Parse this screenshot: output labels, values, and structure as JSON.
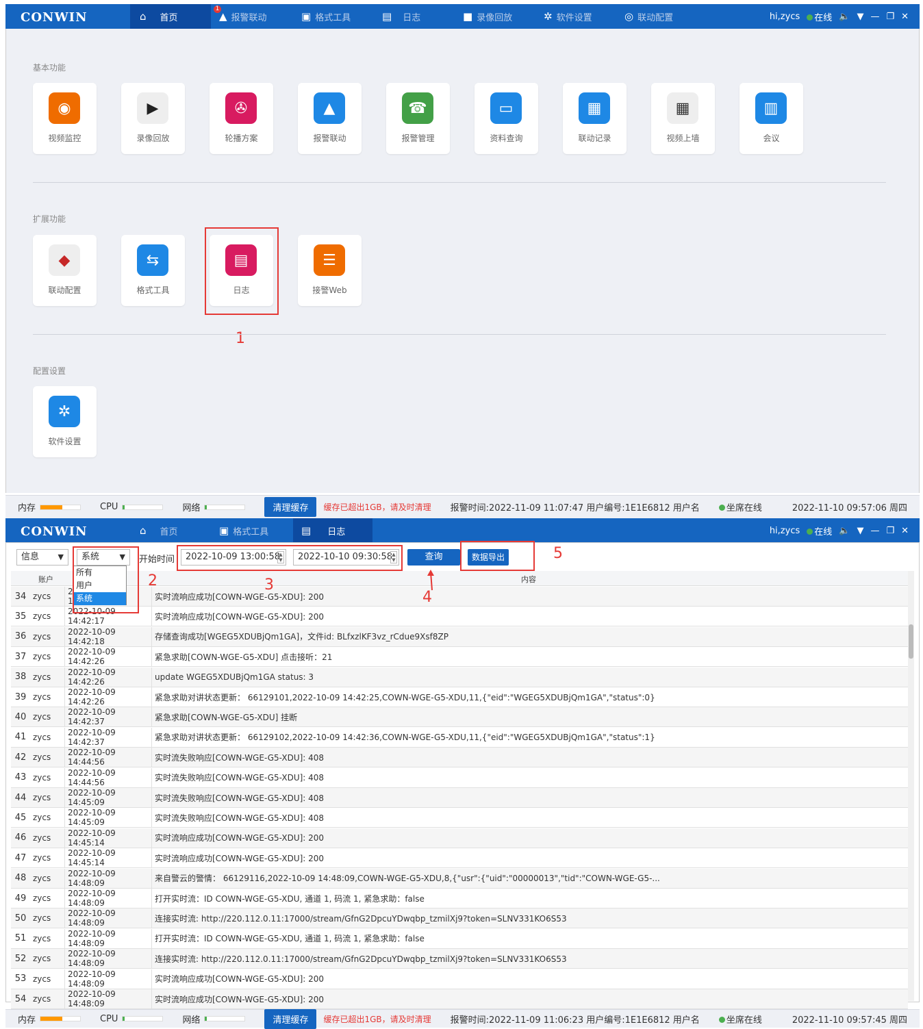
{
  "app": {
    "logo": "CONWIN",
    "user": "hi,zycs",
    "online": "在线"
  },
  "top": {
    "nav": [
      {
        "label": "首页",
        "icon": "home-icon"
      },
      {
        "label": "报警联动",
        "icon": "alarm-icon",
        "badge": "1"
      },
      {
        "label": "格式工具",
        "icon": "tool-icon"
      },
      {
        "label": "日志",
        "icon": "log-icon"
      },
      {
        "label": "录像回放",
        "icon": "video-icon"
      },
      {
        "label": "软件设置",
        "icon": "gear-icon"
      },
      {
        "label": "联动配置",
        "icon": "link-icon"
      }
    ]
  },
  "home": {
    "basic_title": "基本功能",
    "basic": [
      "视频监控",
      "录像回放",
      "轮播方案",
      "报警联动",
      "报警管理",
      "资料查询",
      "联动记录",
      "视频上墙",
      "会议"
    ],
    "ext_title": "扩展功能",
    "ext": [
      "联动配置",
      "格式工具",
      "日志",
      "接警Web"
    ],
    "cfg_title": "配置设置",
    "cfg": [
      "软件设置"
    ],
    "marks": [
      "1",
      "2",
      "3",
      "4",
      "5"
    ]
  },
  "status1": {
    "mem": "内存",
    "cpu": "CPU",
    "net": "网络",
    "clear": "清理缓存",
    "warn": "缓存已超出1GB，请及时清理",
    "alarm": "报警时间:2022-11-09 11:07:47  用户编号:1E1E6812  用户名",
    "seat": "坐席在线",
    "time": "2022-11-10 09:57:06 周四"
  },
  "top2": {
    "nav": [
      {
        "label": "首页"
      },
      {
        "label": "格式工具"
      },
      {
        "label": "日志"
      }
    ]
  },
  "log": {
    "filter1": "信息",
    "filter2": "系统",
    "start_label": "开始时间",
    "start": "2022-10-09 13:00:58",
    "end": "2022-10-10 09:30:58",
    "query": "查询",
    "export": "数据导出",
    "options": [
      "所有",
      "用户",
      "系统"
    ],
    "col_user": "账户",
    "col_content": "内容",
    "rows": [
      [
        "34",
        "zycs",
        "2022-10-09 14:42:17",
        "实时流响应成功[COWN-WGE-G5-XDU]: 200"
      ],
      [
        "35",
        "zycs",
        "2022-10-09 14:42:17",
        "实时流响应成功[COWN-WGE-G5-XDU]: 200"
      ],
      [
        "36",
        "zycs",
        "2022-10-09 14:42:18",
        "存储查询成功[WGEG5XDUBjQm1GA]，文件id: BLfxzlKF3vz_rCdue9Xsf8ZP"
      ],
      [
        "37",
        "zycs",
        "2022-10-09 14:42:26",
        "紧急求助[COWN-WGE-G5-XDU] 点击接听：21"
      ],
      [
        "38",
        "zycs",
        "2022-10-09 14:42:26",
        "update WGEG5XDUBjQm1GA status: 3"
      ],
      [
        "39",
        "zycs",
        "2022-10-09 14:42:26",
        "紧急求助对讲状态更新： 66129101,2022-10-09 14:42:25,COWN-WGE-G5-XDU,11,{\"eid\":\"WGEG5XDUBjQm1GA\",\"status\":0}"
      ],
      [
        "40",
        "zycs",
        "2022-10-09 14:42:37",
        "紧急求助[COWN-WGE-G5-XDU] 挂断"
      ],
      [
        "41",
        "zycs",
        "2022-10-09 14:42:37",
        "紧急求助对讲状态更新： 66129102,2022-10-09 14:42:36,COWN-WGE-G5-XDU,11,{\"eid\":\"WGEG5XDUBjQm1GA\",\"status\":1}"
      ],
      [
        "42",
        "zycs",
        "2022-10-09 14:44:56",
        "实时流失败响应[COWN-WGE-G5-XDU]: 408"
      ],
      [
        "43",
        "zycs",
        "2022-10-09 14:44:56",
        "实时流失败响应[COWN-WGE-G5-XDU]: 408"
      ],
      [
        "44",
        "zycs",
        "2022-10-09 14:45:09",
        "实时流失败响应[COWN-WGE-G5-XDU]: 408"
      ],
      [
        "45",
        "zycs",
        "2022-10-09 14:45:09",
        "实时流失败响应[COWN-WGE-G5-XDU]: 408"
      ],
      [
        "46",
        "zycs",
        "2022-10-09 14:45:14",
        "实时流响应成功[COWN-WGE-G5-XDU]: 200"
      ],
      [
        "47",
        "zycs",
        "2022-10-09 14:45:14",
        "实时流响应成功[COWN-WGE-G5-XDU]: 200"
      ],
      [
        "48",
        "zycs",
        "2022-10-09 14:48:09",
        "来自警云的警情： 66129116,2022-10-09 14:48:09,COWN-WGE-G5-XDU,8,{\"usr\":{\"uid\":\"00000013\",\"tid\":\"COWN-WGE-G5-..."
      ],
      [
        "49",
        "zycs",
        "2022-10-09 14:48:09",
        "打开实时流：ID COWN-WGE-G5-XDU, 通道 1, 码流 1, 紧急求助：false"
      ],
      [
        "50",
        "zycs",
        "2022-10-09 14:48:09",
        "连接实时流: http://220.112.0.11:17000/stream/GfnG2DpcuYDwqbp_tzmilXj9?token=SLNV331KO6S53"
      ],
      [
        "51",
        "zycs",
        "2022-10-09 14:48:09",
        "打开实时流：ID COWN-WGE-G5-XDU, 通道 1, 码流 1, 紧急求助：false"
      ],
      [
        "52",
        "zycs",
        "2022-10-09 14:48:09",
        "连接实时流: http://220.112.0.11:17000/stream/GfnG2DpcuYDwqbp_tzmilXj9?token=SLNV331KO6S53"
      ],
      [
        "53",
        "zycs",
        "2022-10-09 14:48:09",
        "实时流响应成功[COWN-WGE-G5-XDU]: 200"
      ],
      [
        "54",
        "zycs",
        "2022-10-09 14:48:09",
        "实时流响应成功[COWN-WGE-G5-XDU]: 200"
      ]
    ]
  },
  "status2": {
    "alarm": "报警时间:2022-11-09 11:06:23  用户编号:1E1E6812  用户名",
    "time": "2022-11-10 09:57:45 周四"
  }
}
